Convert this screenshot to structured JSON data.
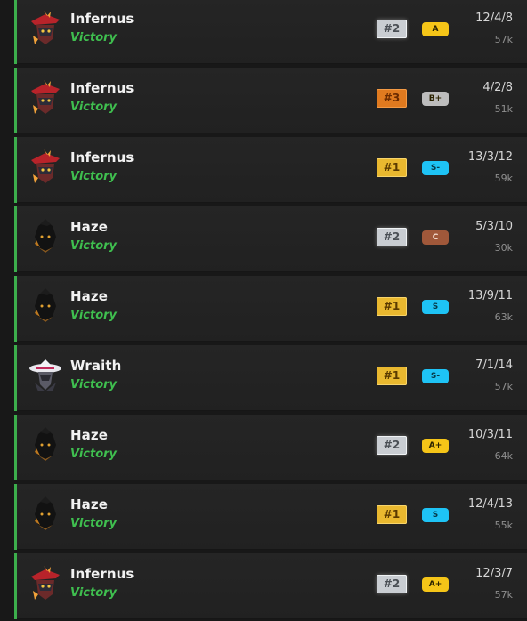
{
  "matches": [
    {
      "hero": "Infernus",
      "result": "Victory",
      "rank": "#2",
      "rank_tier": "silver",
      "grade": "A",
      "grade_color": "#f5c518",
      "kda": "12/4/8",
      "souls": "57k",
      "avatar_icon": "infernus-icon"
    },
    {
      "hero": "Infernus",
      "result": "Victory",
      "rank": "#3",
      "rank_tier": "bronze",
      "grade": "B+",
      "grade_color": "#bdbdbd",
      "kda": "4/2/8",
      "souls": "51k",
      "avatar_icon": "infernus-icon"
    },
    {
      "hero": "Infernus",
      "result": "Victory",
      "rank": "#1",
      "rank_tier": "gold",
      "grade": "S-",
      "grade_color": "#1ec3f5",
      "kda": "13/3/12",
      "souls": "59k",
      "avatar_icon": "infernus-icon"
    },
    {
      "hero": "Haze",
      "result": "Victory",
      "rank": "#2",
      "rank_tier": "silver",
      "grade": "C",
      "grade_color": "#a0583a",
      "kda": "5/3/10",
      "souls": "30k",
      "avatar_icon": "haze-icon"
    },
    {
      "hero": "Haze",
      "result": "Victory",
      "rank": "#1",
      "rank_tier": "gold",
      "grade": "S",
      "grade_color": "#1ec3f5",
      "kda": "13/9/11",
      "souls": "63k",
      "avatar_icon": "haze-icon"
    },
    {
      "hero": "Wraith",
      "result": "Victory",
      "rank": "#1",
      "rank_tier": "gold",
      "grade": "S-",
      "grade_color": "#1ec3f5",
      "kda": "7/1/14",
      "souls": "57k",
      "avatar_icon": "wraith-icon"
    },
    {
      "hero": "Haze",
      "result": "Victory",
      "rank": "#2",
      "rank_tier": "silver",
      "grade": "A+",
      "grade_color": "#f5c518",
      "kda": "10/3/11",
      "souls": "64k",
      "avatar_icon": "haze-icon"
    },
    {
      "hero": "Haze",
      "result": "Victory",
      "rank": "#1",
      "rank_tier": "gold",
      "grade": "S",
      "grade_color": "#1ec3f5",
      "kda": "12/4/13",
      "souls": "55k",
      "avatar_icon": "haze-icon"
    },
    {
      "hero": "Infernus",
      "result": "Victory",
      "rank": "#2",
      "rank_tier": "silver",
      "grade": "A+",
      "grade_color": "#f5c518",
      "kda": "12/3/7",
      "souls": "57k",
      "avatar_icon": "infernus-icon"
    }
  ],
  "colors": {
    "victory": "#3fbf4f",
    "row_accent": "#3cae4c",
    "gold": "#e9b82f",
    "silver": "#c9cdd2",
    "bronze": "#e07a1f"
  }
}
